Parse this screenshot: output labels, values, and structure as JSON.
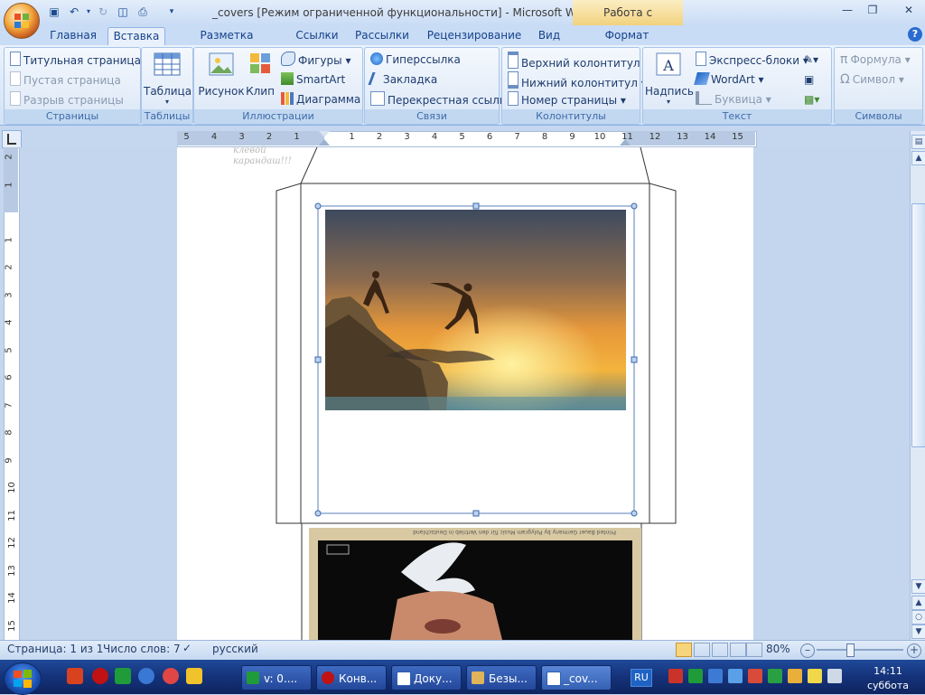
{
  "window": {
    "title": "_covers [Режим ограниченной функциональности] - Microsoft Word",
    "context_tab_title": "Работа с надписями"
  },
  "tabs": [
    "Главная",
    "Вставка",
    "Разметка страницы",
    "Ссылки",
    "Рассылки",
    "Рецензирование",
    "Вид",
    "Формат"
  ],
  "active_tab": "Вставка",
  "ribbon": {
    "pages": {
      "label": "Страницы",
      "items": [
        "Титульная страница",
        "Пустая страница",
        "Разрыв страницы"
      ]
    },
    "tables": {
      "label": "Таблицы",
      "table": "Таблица"
    },
    "illustrations": {
      "label": "Иллюстрации",
      "picture": "Рисунок",
      "clip": "Клип",
      "shapes": "Фигуры",
      "smartart": "SmartArt",
      "chart": "Диаграмма"
    },
    "links": {
      "label": "Связи",
      "items": [
        "Гиперссылка",
        "Закладка",
        "Перекрестная ссылка"
      ]
    },
    "header_footer": {
      "label": "Колонтитулы",
      "items": [
        "Верхний колонтитул",
        "Нижний колонтитул",
        "Номер страницы"
      ]
    },
    "text": {
      "label": "Текст",
      "textbox": "Надпись",
      "items": [
        "Экспресс-блоки",
        "WordArt",
        "Буквица"
      ]
    },
    "symbols": {
      "label": "Символы",
      "items": [
        "Формула",
        "Символ"
      ]
    }
  },
  "ruler": {
    "h_ticks": [
      "5",
      "4",
      "3",
      "2",
      "1",
      "1",
      "2",
      "3",
      "4",
      "5",
      "6",
      "7",
      "8",
      "9",
      "10",
      "11",
      "12",
      "13",
      "14",
      "15"
    ],
    "v_ticks": [
      "2",
      "1",
      "1",
      "2",
      "3",
      "4",
      "5",
      "6",
      "7",
      "8",
      "9",
      "10",
      "11",
      "12",
      "13",
      "14",
      "15"
    ]
  },
  "document": {
    "faint_text_1": "клевой",
    "faint_text_2": "карандаш!!!",
    "bottom_image_text": "Printed Bauer Germany by Polygram Music für den Vertrieb in Deutschland"
  },
  "status": {
    "page": "Страница: 1 из 1",
    "words": "Число слов: 7",
    "language": "русский",
    "zoom": "80%"
  },
  "taskbar": {
    "tasks": [
      "v: 0....",
      "Конв...",
      "Доку...",
      "Безы...",
      "_cov..."
    ],
    "active_task": "_cov...",
    "language": "RU",
    "time": "14:11",
    "day": "суббота"
  }
}
